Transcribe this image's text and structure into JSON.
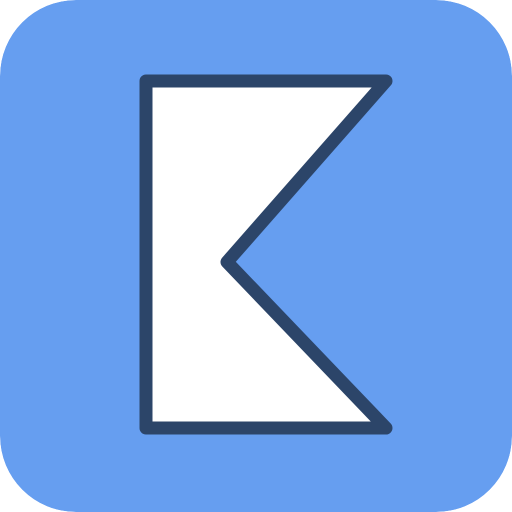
{
  "icon": {
    "name": "logo-icon",
    "colors": {
      "background": "#669EF0",
      "fill": "#FFFFFF",
      "stroke": "#2C4569"
    }
  }
}
